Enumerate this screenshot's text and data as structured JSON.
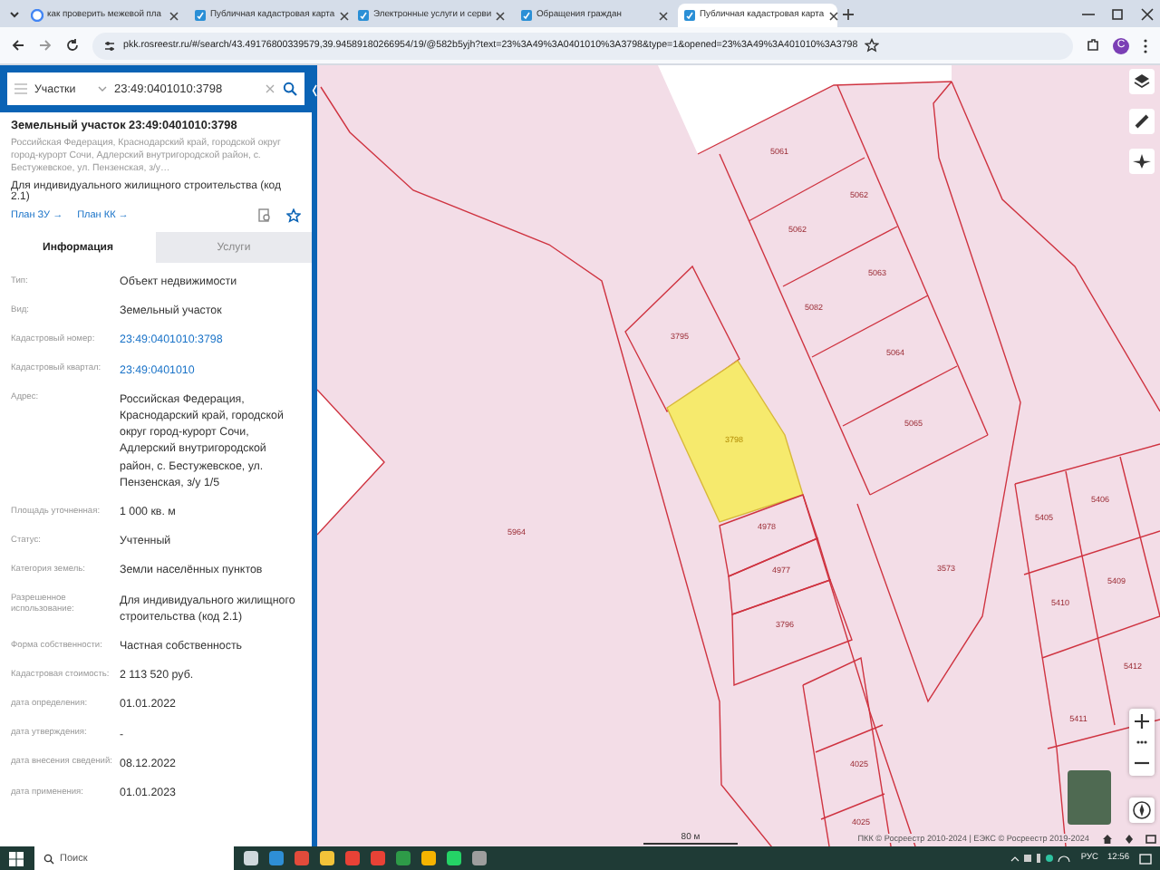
{
  "browser": {
    "tabs": [
      {
        "title": "как проверить межевой пла",
        "selected": false,
        "kind": "search"
      },
      {
        "title": "Публичная кадастровая карта",
        "selected": false,
        "kind": "page"
      },
      {
        "title": "Электронные услуги и серви",
        "selected": false,
        "kind": "page"
      },
      {
        "title": "Обращения граждан",
        "selected": false,
        "kind": "page"
      },
      {
        "title": "Публичная кадастровая карта",
        "selected": true,
        "kind": "page"
      }
    ],
    "address": "pkk.rosreestr.ru/#/search/43.49176800339579,39.94589180266954/19/@582b5yjh?text=23%3A49%3A0401010%3A3798&type=1&opened=23%3A49%3A401010%3A3798",
    "profile": "С"
  },
  "panel": {
    "layer": "Участки",
    "search_value": "23:49:0401010:3798",
    "title": "Земельный участок 23:49:0401010:3798",
    "address": "Российская Федерация, Краснодарский край, городской округ город-курорт Сочи, Адлерский внутригородской район, с. Бестужевское, ул. Пензенская, з/у…",
    "purpose": "Для индивидуального жилищного строительства (код 2.1)",
    "links": [
      "План ЗУ →",
      "План КК →"
    ],
    "tabs": [
      {
        "label": "Информация",
        "selected": true
      },
      {
        "label": "Услуги",
        "selected": false
      }
    ],
    "fields": [
      {
        "label": "Тип:",
        "value": "Объект недвижимости",
        "kind": "text"
      },
      {
        "label": "Вид:",
        "value": "Земельный участок",
        "kind": "text"
      },
      {
        "label": "Кадастровый номер:",
        "value": "23:49:0401010:3798",
        "kind": "link"
      },
      {
        "label": "Кадастровый квартал:",
        "value": "23:49:0401010",
        "kind": "link"
      },
      {
        "label": "Адрес:",
        "value": "Российская Федерация, Краснодарский край, городской округ город-курорт Сочи, Адлерский внутригородской район, с. Бестужевское, ул. Пензенская, з/у 1/5",
        "kind": "text"
      },
      {
        "label": "Площадь уточненная:",
        "value": "1 000 кв. м",
        "kind": "text"
      },
      {
        "label": "Статус:",
        "value": "Учтенный",
        "kind": "text"
      },
      {
        "label": "Категория земель:",
        "value": "Земли населённых пунктов",
        "kind": "text"
      },
      {
        "label": "Разрешенное использование:",
        "value": "Для индивидуального жилищного строительства (код 2.1)",
        "kind": "text"
      },
      {
        "label": "Форма собственности:",
        "value": "Частная собственность",
        "kind": "text"
      },
      {
        "label": "Кадастровая стоимость:",
        "value": "2 113 520 руб.",
        "kind": "text"
      },
      {
        "label": "дата определения:",
        "value": "01.01.2022",
        "kind": "text"
      },
      {
        "label": "дата утверждения:",
        "value": "-",
        "kind": "text"
      },
      {
        "label": "дата внесения сведений:",
        "value": "08.12.2022",
        "kind": "text"
      },
      {
        "label": "дата применения:",
        "value": "01.01.2023",
        "kind": "text"
      }
    ]
  },
  "map": {
    "parcels": [
      {
        "number": "5061",
        "selected": false
      },
      {
        "number": "5062",
        "selected": false
      },
      {
        "number": "5062",
        "selected": false
      },
      {
        "number": "5063",
        "selected": false
      },
      {
        "number": "5082",
        "selected": false
      },
      {
        "number": "5064",
        "selected": false
      },
      {
        "number": "5065",
        "selected": false
      },
      {
        "number": "3795",
        "selected": false
      },
      {
        "number": "3798",
        "selected": true
      },
      {
        "number": "5964",
        "selected": false
      },
      {
        "number": "4978",
        "selected": false
      },
      {
        "number": "4977",
        "selected": false
      },
      {
        "number": "3796",
        "selected": false
      },
      {
        "number": "3573",
        "selected": false
      },
      {
        "number": "5405",
        "selected": false
      },
      {
        "number": "5406",
        "selected": false
      },
      {
        "number": "5409",
        "selected": false
      },
      {
        "number": "5410",
        "selected": false
      },
      {
        "number": "5412",
        "selected": false
      },
      {
        "number": "5411",
        "selected": false
      },
      {
        "number": "4025",
        "selected": false
      },
      {
        "number": "4025",
        "selected": false
      }
    ],
    "scale": "80 м",
    "attribution": "ПКК © Росреестр 2010-2024 | ЕЭКС © Росреестр 2019-2024"
  },
  "taskbar": {
    "search_placeholder": "Поиск",
    "language": "РУС",
    "time": "12:56"
  }
}
